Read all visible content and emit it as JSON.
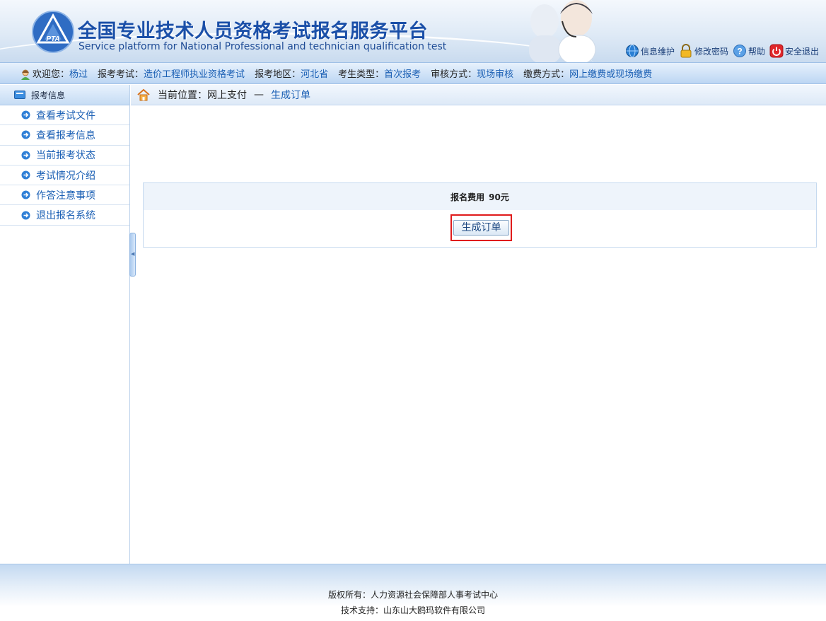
{
  "header": {
    "title": "全国专业技术人员资格考试报名服务平台",
    "subtitle": "Service platform for National Professional and technician qualification test",
    "logo_text": "PTA",
    "links": [
      {
        "label": "信息维护",
        "icon": "globe-icon"
      },
      {
        "label": "修改密码",
        "icon": "lock-icon"
      },
      {
        "label": "帮助",
        "icon": "help-icon"
      },
      {
        "label": "安全退出",
        "icon": "power-icon"
      }
    ]
  },
  "info_bar": {
    "welcome_label": "欢迎您：",
    "welcome_value": "杨过",
    "exam_label": "报考考试：",
    "exam_value": "造价工程师执业资格考试",
    "region_label": "报考地区：",
    "region_value": "河北省",
    "type_label": "考生类型：",
    "type_value": "首次报考",
    "review_label": "审核方式：",
    "review_value": "现场审核",
    "payment_label": "缴费方式：",
    "payment_value": "网上缴费或现场缴费"
  },
  "sidebar": {
    "header": "报考信息",
    "items": [
      {
        "label": "查看考试文件"
      },
      {
        "label": "查看报考信息"
      },
      {
        "label": "当前报考状态"
      },
      {
        "label": "考试情况介绍"
      },
      {
        "label": "作答注意事项"
      },
      {
        "label": "退出报名系统"
      }
    ]
  },
  "breadcrumb": {
    "prefix": "当前位置：",
    "parent": "网上支付",
    "separator": "—",
    "current": "生成订单"
  },
  "fee": {
    "label": "报名费用",
    "amount": "90元",
    "button_label": "生成订单"
  },
  "footer": {
    "copyright": "版权所有：人力资源社会保障部人事考试中心",
    "support": "技术支持：山东山大鸥玛软件有限公司"
  },
  "colors": {
    "accent": "#1a5fb4",
    "highlight_border": "#e01b1b",
    "title": "#1a4fa8"
  }
}
